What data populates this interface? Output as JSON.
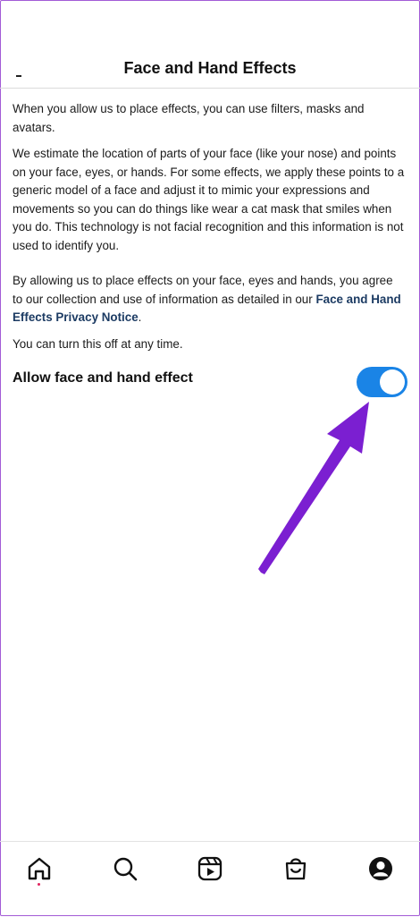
{
  "header": {
    "title": "Face and Hand Effects"
  },
  "content": {
    "paragraph_1": "When you allow us to place effects, you can use filters, masks and avatars.",
    "paragraph_2": "We estimate the location of parts of your face (like your nose) and points on your face, eyes, or hands. For some effects, we apply these points to a generic model of a face and adjust it to mimic your expressions and movements so you can do things like wear a cat mask that smiles when you do. This technology is not facial recognition and this information is not used to identify you.",
    "paragraph_3_text": "By allowing us to place effects on your face, eyes and hands, you agree to our collection and use of information as detailed in our ",
    "paragraph_3_link": "Face and Hand Effects Privacy Notice",
    "paragraph_3_end": ".",
    "paragraph_4": "You can turn this off at any time."
  },
  "setting": {
    "label": "Allow face and hand effect",
    "enabled": true,
    "toggle_color": "#1a84e6"
  },
  "annotation": {
    "arrow_color": "#7b1fd1"
  },
  "bottom_nav": {
    "items": [
      {
        "icon": "home-icon",
        "active": true
      },
      {
        "icon": "search-icon"
      },
      {
        "icon": "reels-icon"
      },
      {
        "icon": "shop-icon"
      },
      {
        "icon": "profile-icon"
      }
    ],
    "notification_dot_color": "#e0245e"
  }
}
